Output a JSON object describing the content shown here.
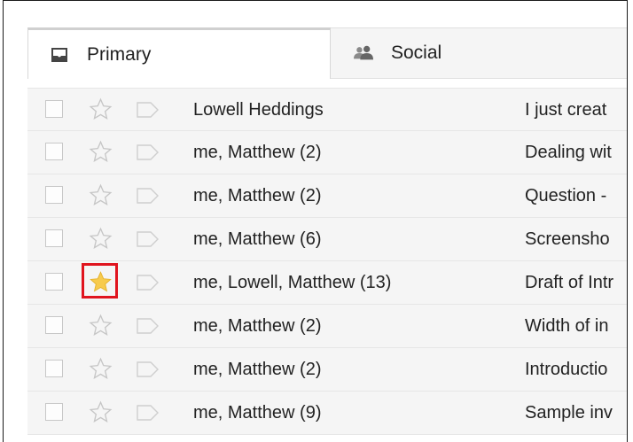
{
  "tabs": [
    {
      "label": "Primary",
      "icon": "inbox-icon",
      "selected": true
    },
    {
      "label": "Social",
      "icon": "people-icon",
      "selected": false
    }
  ],
  "rows": [
    {
      "sender": "Lowell Heddings",
      "subject": "I just creat",
      "starred": false
    },
    {
      "sender": "me, Matthew (2)",
      "subject": "Dealing wit",
      "starred": false
    },
    {
      "sender": "me, Matthew (2)",
      "subject": "Question -",
      "starred": false
    },
    {
      "sender": "me, Matthew (6)",
      "subject": "Screensho",
      "starred": false
    },
    {
      "sender": "me, Lowell, Matthew (13)",
      "subject": "Draft of Intr",
      "starred": true,
      "highlighted": true
    },
    {
      "sender": "me, Matthew (2)",
      "subject": "Width of in",
      "starred": false
    },
    {
      "sender": "me, Matthew (2)",
      "subject": "Introductio",
      "starred": false
    },
    {
      "sender": "me, Matthew (9)",
      "subject": "Sample inv",
      "starred": false
    }
  ],
  "colors": {
    "star_filled": "#f7cb4d",
    "star_outline": "#c6c6c6",
    "highlight_box": "#e0141e",
    "row_bg": "#f5f5f5"
  }
}
